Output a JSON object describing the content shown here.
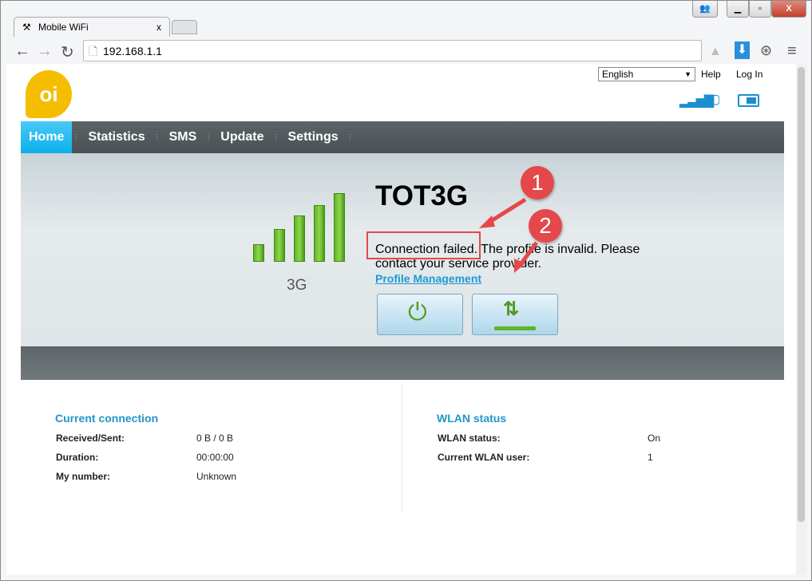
{
  "browser": {
    "tab_title": "Mobile WiFi",
    "tab_close": "x",
    "url": "192.168.1.1"
  },
  "header": {
    "language": "English",
    "help": "Help",
    "login": "Log In",
    "logo": "oi"
  },
  "nav": [
    {
      "label": "Home",
      "active": true
    },
    {
      "label": "Statistics"
    },
    {
      "label": "SMS"
    },
    {
      "label": "Update"
    },
    {
      "label": "Settings"
    }
  ],
  "status": {
    "network_name": "TOT3G",
    "network_type": "3G",
    "signal_bars": 5,
    "message": "Connection failed. The profile is invalid. Please contact your service provider.",
    "link": "Profile Management"
  },
  "annotations": [
    "1",
    "2"
  ],
  "current_connection": {
    "title": "Current connection",
    "rows": [
      {
        "label": "Received/Sent:",
        "value": "0 B /  0 B"
      },
      {
        "label": "Duration:",
        "value": "00:00:00"
      },
      {
        "label": "My number:",
        "value": "Unknown"
      }
    ]
  },
  "wlan": {
    "title": "WLAN status",
    "rows": [
      {
        "label": "WLAN status:",
        "value": "On"
      },
      {
        "label": "Current WLAN user:",
        "value": "1"
      }
    ]
  },
  "colors": {
    "accent": "#0bb1ea",
    "annotation": "#e5484a",
    "signal": "#5fb42a"
  }
}
